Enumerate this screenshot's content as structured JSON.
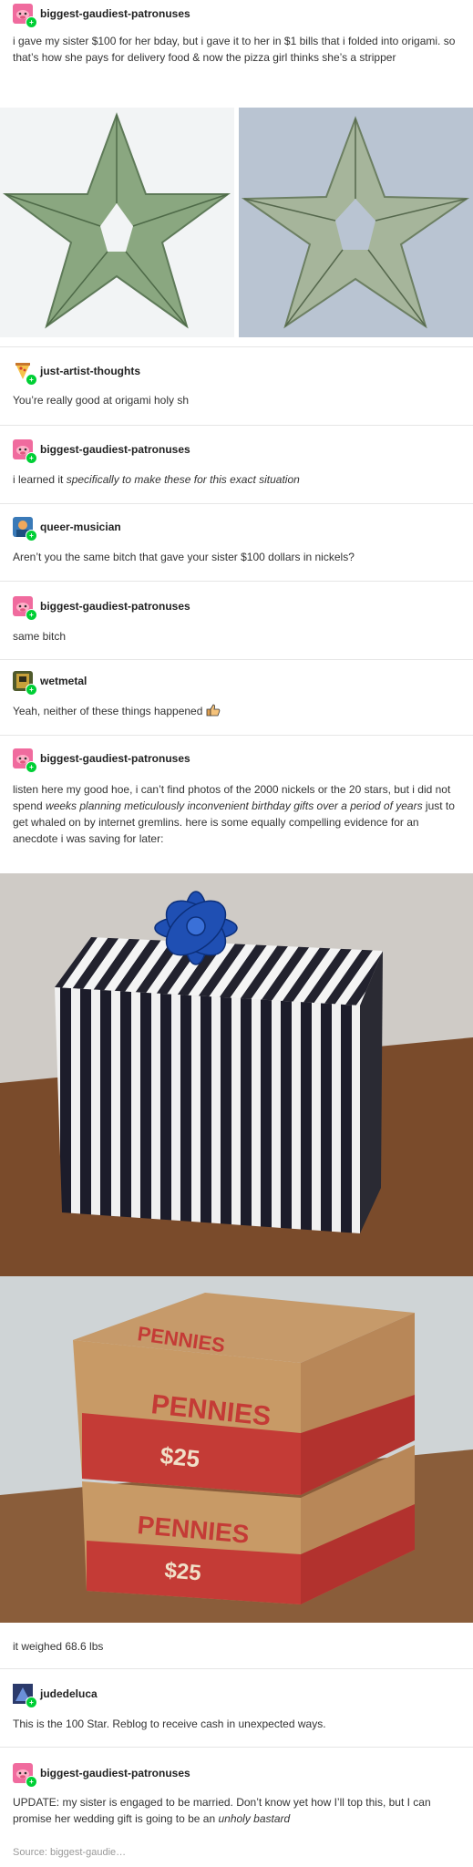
{
  "posts": [
    {
      "user": "biggest-gaudiest-patronuses",
      "text": "i gave my sister $100 for her bday, but i gave it to her in $1 bills that i folded into origami. so that’s how she pays for delivery food & now the pizza girl thinks she’s a stripper"
    },
    {
      "user": "just-artist-thoughts",
      "text": "You’re really good at origami holy sh"
    },
    {
      "user": "biggest-gaudiest-patronuses",
      "text_plain": "i learned it ",
      "text_italic": "specifically to make these for this exact situation"
    },
    {
      "user": "queer-musician",
      "text": "Aren’t you the same bitch that gave your sister $100 dollars in nickels?"
    },
    {
      "user": "biggest-gaudiest-patronuses",
      "text": "same bitch"
    },
    {
      "user": "wetmetal",
      "text": "Yeah, neither of these things happened"
    },
    {
      "user": "biggest-gaudiest-patronuses",
      "text_a": "listen here my good hoe, i can’t find photos of the 2000 nickels or the 20 stars, but i did not spend ",
      "text_italic": "weeks planning meticulously inconvenient birthday gifts over a period of years",
      "text_b": " just to get whaled on by internet gremlins. here is some equally compelling evidence for an anecdote i was saving for later:",
      "caption": "it weighed 68.6 lbs"
    },
    {
      "user": "judedeluca",
      "text": "This is the 100 Star. Reblog to receive cash in unexpected ways."
    },
    {
      "user": "biggest-gaudiest-patronuses",
      "text_a": "UPDATE: my sister is engaged to be married. Don’t know yet how I’ll top this, but I can promise her wedding gift is going to be an ",
      "text_italic": "unholy bastard"
    }
  ],
  "pennies_box": {
    "label": "PENNIES",
    "value": "$25"
  },
  "source": "Source:  biggest-gaudie…",
  "colors": {
    "accent_badge": "#00cf35",
    "divider": "#e6e6e6"
  },
  "icons": {
    "thumbs_up": "thumbs-up-icon",
    "follow_badge": "plus-badge-icon"
  }
}
